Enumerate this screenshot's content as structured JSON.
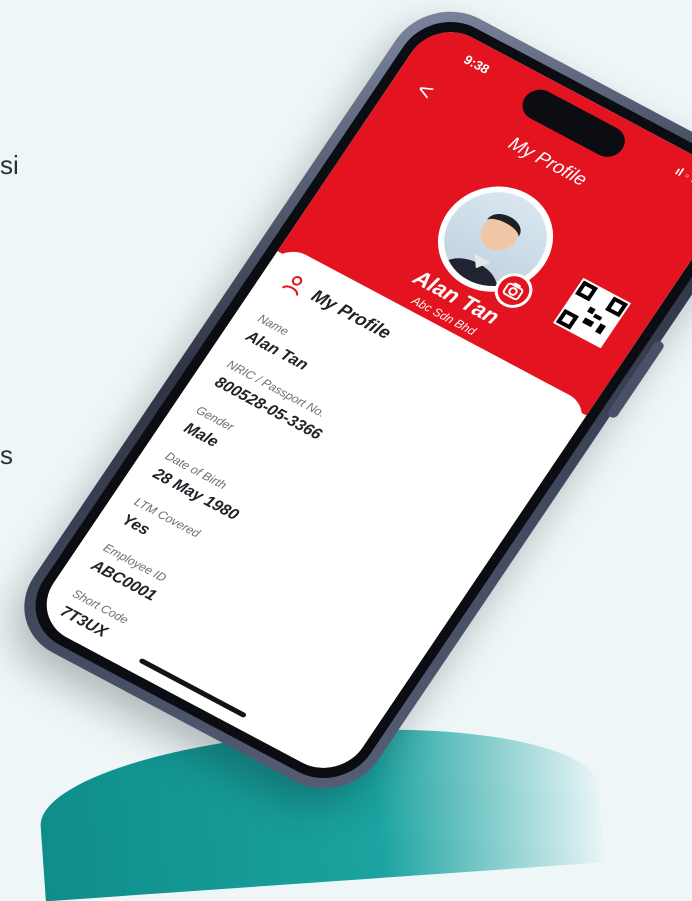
{
  "background": {
    "left_text_top": "si",
    "left_text_mid": "s"
  },
  "status_bar": {
    "time": "9:38",
    "icons": "ıl ◦ ▭"
  },
  "header": {
    "back_symbol": "<",
    "title": "My Profile",
    "user_name": "Alan Tan",
    "company": "Abc Sdn Bhd"
  },
  "profile_card": {
    "title": "My Profile",
    "fields": [
      {
        "label": "Name",
        "value": "Alan Tan"
      },
      {
        "label": "NRIC / Passport No.",
        "value": "800528-05-3366"
      },
      {
        "label": "Gender",
        "value": "Male"
      },
      {
        "label": "Date of Birth",
        "value": "28 May 1980"
      },
      {
        "label": "LTM Covered",
        "value": "Yes"
      },
      {
        "label": "Employee ID",
        "value": "ABC0001"
      },
      {
        "label": "Short Code",
        "value": "7T3UX"
      }
    ]
  },
  "colors": {
    "brand_red": "#e3141f",
    "screen_bg": "#ffffff",
    "frame": "#2f3546"
  }
}
